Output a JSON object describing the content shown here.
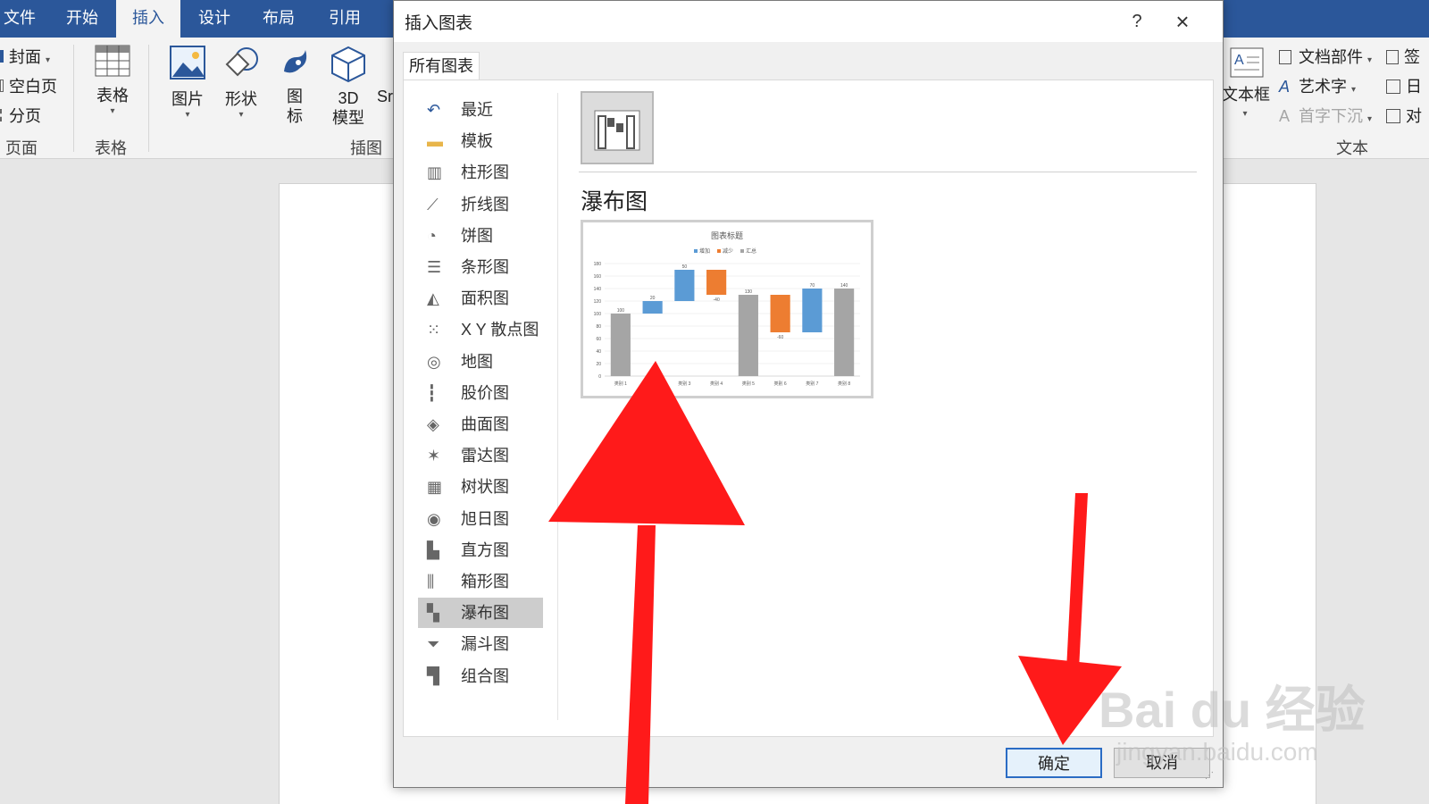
{
  "ribbon": {
    "tabs": [
      "文件",
      "开始",
      "插入",
      "设计",
      "布局",
      "引用"
    ],
    "active_tab": "插入",
    "page_group": {
      "label": "页面",
      "items": [
        "封面",
        "空白页",
        "分页"
      ]
    },
    "table_group": {
      "label": "表格",
      "button": "表格"
    },
    "illustrations_group": {
      "label": "插图",
      "picture": "图片",
      "shapes": "形状",
      "icons_line1": "图",
      "icons_line2": "标",
      "model_line1": "3D",
      "model_line2": "模型",
      "smartart_partial": "Sr"
    },
    "text_group": {
      "label": "文本",
      "textbox": "文本框",
      "quick_parts": "文档部件",
      "wordart": "艺术字",
      "dropcap": "首字下沉",
      "signature_partial": "签",
      "datetime_partial": "日",
      "object_partial": "对"
    }
  },
  "dialog": {
    "title": "插入图表",
    "help": "?",
    "tab": "所有图表",
    "categories": [
      {
        "label": "最近",
        "icon": "recent-icon"
      },
      {
        "label": "模板",
        "icon": "folder-icon"
      },
      {
        "label": "柱形图",
        "icon": "column-chart-icon"
      },
      {
        "label": "折线图",
        "icon": "line-chart-icon"
      },
      {
        "label": "饼图",
        "icon": "pie-chart-icon"
      },
      {
        "label": "条形图",
        "icon": "bar-chart-icon"
      },
      {
        "label": "面积图",
        "icon": "area-chart-icon"
      },
      {
        "label": "X Y 散点图",
        "icon": "scatter-chart-icon"
      },
      {
        "label": "地图",
        "icon": "map-chart-icon"
      },
      {
        "label": "股价图",
        "icon": "stock-chart-icon"
      },
      {
        "label": "曲面图",
        "icon": "surface-chart-icon"
      },
      {
        "label": "雷达图",
        "icon": "radar-chart-icon"
      },
      {
        "label": "树状图",
        "icon": "treemap-chart-icon"
      },
      {
        "label": "旭日图",
        "icon": "sunburst-chart-icon"
      },
      {
        "label": "直方图",
        "icon": "histogram-chart-icon"
      },
      {
        "label": "箱形图",
        "icon": "boxwhisker-chart-icon"
      },
      {
        "label": "瀑布图",
        "icon": "waterfall-chart-icon"
      },
      {
        "label": "漏斗图",
        "icon": "funnel-chart-icon"
      },
      {
        "label": "组合图",
        "icon": "combo-chart-icon"
      }
    ],
    "selected_category": "瀑布图",
    "chart_title": "瀑布图",
    "ok": "确定",
    "cancel": "取消"
  },
  "chart_data": {
    "type": "bar",
    "subtype": "waterfall",
    "title": "图表标题",
    "legend": [
      "增加",
      "减少",
      "汇总"
    ],
    "legend_position": "top",
    "categories": [
      "类别 1",
      "类别 2",
      "类别 3",
      "类别 4",
      "类别 5",
      "类别 6",
      "类别 7",
      "类别 8"
    ],
    "values": [
      100,
      20,
      50,
      -40,
      130,
      -60,
      70,
      140
    ],
    "labels": [
      "100",
      "20",
      "50",
      "-40",
      "130",
      "-60",
      "70",
      "140"
    ],
    "kinds": [
      "total",
      "increase",
      "increase",
      "decrease",
      "total",
      "decrease",
      "increase",
      "total"
    ],
    "yticks": [
      0,
      20,
      40,
      60,
      80,
      100,
      120,
      140,
      160,
      180
    ],
    "ylim": [
      0,
      180
    ],
    "colors": {
      "increase": "#5b9bd5",
      "decrease": "#ed7d31",
      "total": "#a5a5a5"
    },
    "grid": true
  },
  "watermark": {
    "brand": "Bai du 经验",
    "url": "jingyan.baidu.com"
  },
  "colors": {
    "ribbon": "#2b579a",
    "arrow": "#ff1a1a"
  }
}
